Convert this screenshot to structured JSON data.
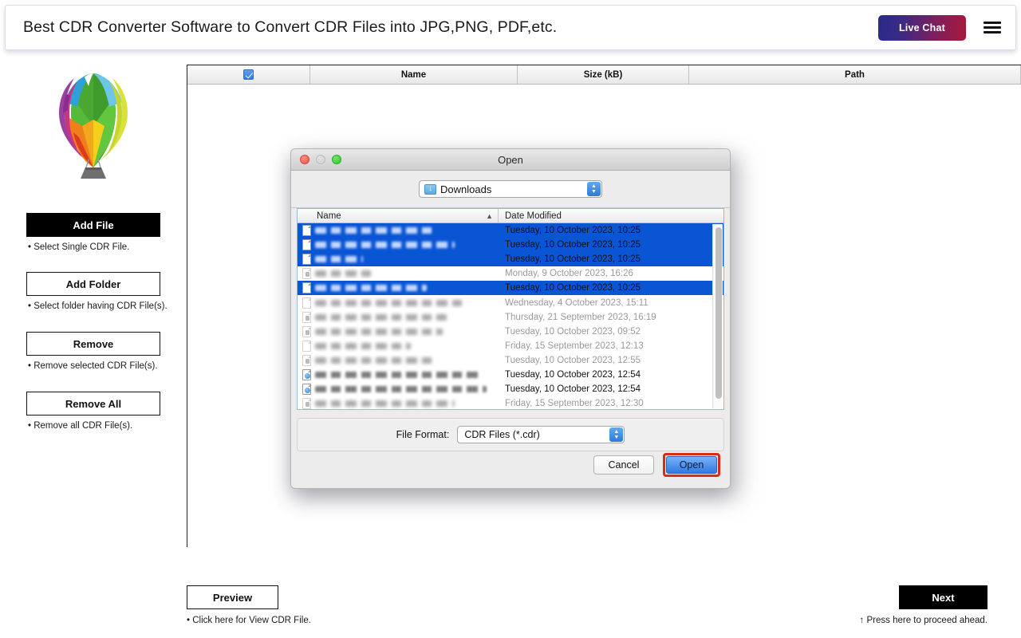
{
  "header": {
    "title": "Best CDR Converter Software to Convert CDR Files into JPG,PNG, PDF,etc.",
    "live_chat_label": "Live Chat",
    "menu_icon": "hamburger-icon",
    "live_chat_gradient_from": "#2b2a8c",
    "live_chat_gradient_to": "#a81838"
  },
  "sidebar": {
    "logo_icon": "hot-air-balloon-logo",
    "buttons": [
      {
        "label": "Add File",
        "hint": "• Select Single CDR File.",
        "style": "primary"
      },
      {
        "label": "Add Folder",
        "hint": "• Select folder having CDR File(s).",
        "style": "default"
      },
      {
        "label": "Remove",
        "hint": "• Remove selected CDR File(s).",
        "style": "default"
      },
      {
        "label": "Remove All",
        "hint": "• Remove all CDR File(s).",
        "style": "default"
      }
    ]
  },
  "file_table": {
    "select_all_checked": true,
    "columns": [
      "",
      "Name",
      "Size (kB)",
      "Path"
    ],
    "rows": []
  },
  "dialog": {
    "title": "Open",
    "traffic_lights": [
      "close-icon",
      "minimize-icon",
      "zoom-icon"
    ],
    "location": {
      "label": "Downloads",
      "icon": "downloads-folder-icon"
    },
    "list_columns": {
      "name": "Name",
      "date_modified": "Date Modified",
      "sort_icon": "chevron-up-icon"
    },
    "files": [
      {
        "name": "",
        "date": "Tuesday, 10 October 2023, 10:25",
        "selected": true,
        "icon": "cdr-file-icon",
        "state": "dark"
      },
      {
        "name": "",
        "date": "Tuesday, 10 October 2023, 10:25",
        "selected": true,
        "icon": "cdr-file-icon",
        "state": "dark"
      },
      {
        "name": "",
        "date": "Tuesday, 10 October 2023, 10:25",
        "selected": true,
        "icon": "cdr-file-icon",
        "state": "dark"
      },
      {
        "name": "",
        "date": "Monday, 9 October 2023, 16:26",
        "selected": false,
        "icon": "locked-file-icon",
        "state": "dim"
      },
      {
        "name": "",
        "date": "Tuesday, 10 October 2023, 10:25",
        "selected": true,
        "icon": "cdr-file-icon",
        "state": "dark"
      },
      {
        "name": "",
        "date": "Wednesday, 4 October 2023, 15:11",
        "selected": false,
        "icon": "text-file-icon",
        "state": "dim"
      },
      {
        "name": "",
        "date": "Thursday, 21 September 2023, 16:19",
        "selected": false,
        "icon": "locked-file-icon",
        "state": "dim"
      },
      {
        "name": "",
        "date": "Tuesday, 10 October 2023, 09:52",
        "selected": false,
        "icon": "locked-file-icon",
        "state": "dim"
      },
      {
        "name": "",
        "date": "Friday, 15 September 2023, 12:13",
        "selected": false,
        "icon": "blank-file-icon",
        "state": "dim"
      },
      {
        "name": "",
        "date": "Tuesday, 10 October 2023, 12:55",
        "selected": false,
        "icon": "locked-file-icon",
        "state": "dim"
      },
      {
        "name": "",
        "date": "Tuesday, 10 October 2023, 12:54",
        "selected": false,
        "icon": "dmg-file-icon",
        "state": "dark"
      },
      {
        "name": "",
        "date": "Tuesday, 10 October 2023, 12:54",
        "selected": false,
        "icon": "dmg-file-icon",
        "state": "dark"
      },
      {
        "name": "",
        "date": "Friday, 15 September 2023, 12:30",
        "selected": false,
        "icon": "locked-file-icon",
        "state": "dim"
      }
    ],
    "file_format": {
      "label": "File Format:",
      "value": "CDR Files (*.cdr)"
    },
    "cancel_label": "Cancel",
    "open_label": "Open",
    "open_highlight_color": "#d92b16",
    "selection_color": "#0a55d4"
  },
  "footer": {
    "preview_label": "Preview",
    "preview_hint": "• Click here for View CDR File.",
    "next_label": "Next",
    "next_hint": "↑ Press here to proceed ahead."
  }
}
